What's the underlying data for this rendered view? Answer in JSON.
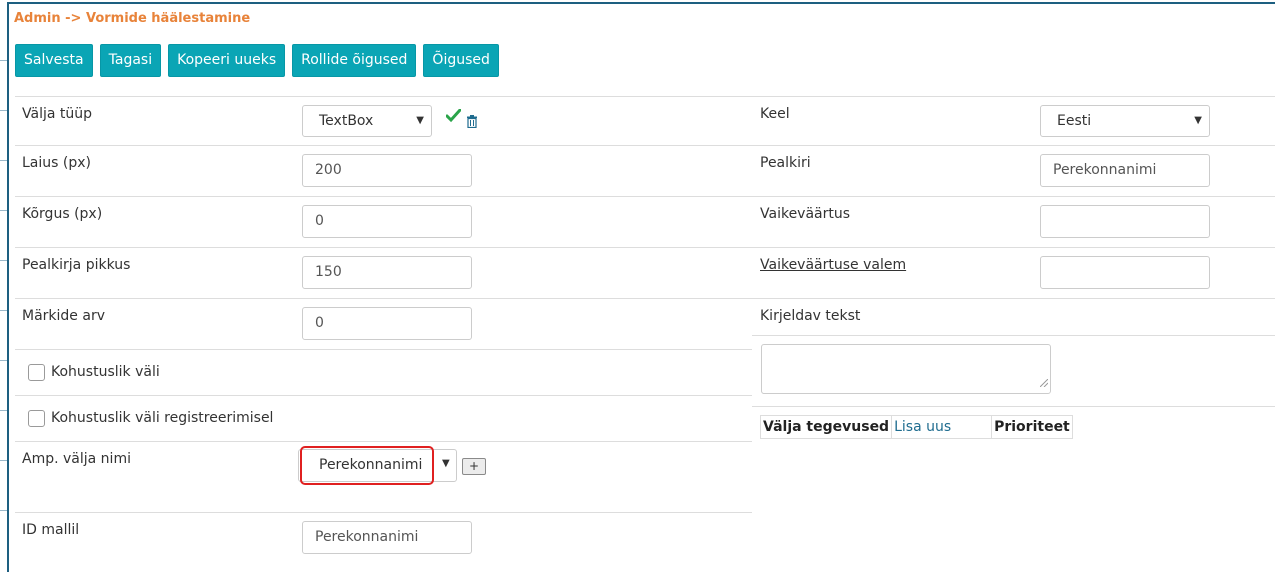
{
  "breadcrumb": "Admin -> Vormide häälestamine",
  "toolbar": {
    "save": "Salvesta",
    "back": "Tagasi",
    "copy_new": "Kopeeri uueks",
    "role_rights": "Rollide õigused",
    "rights": "Õigused"
  },
  "left": {
    "field_type": {
      "label": "Välja tüüp",
      "value": "TextBox"
    },
    "width": {
      "label": "Laius (px)",
      "value": "200"
    },
    "height": {
      "label": "Kõrgus (px)",
      "value": "0"
    },
    "title_length": {
      "label": "Pealkirja pikkus",
      "value": "150"
    },
    "char_count": {
      "label": "Märkide arv",
      "value": "0"
    },
    "required": {
      "label": "Kohustuslik väli",
      "checked": false
    },
    "required_reg": {
      "label": "Kohustuslik väli registreerimisel",
      "checked": false
    },
    "amp_field": {
      "label": "Amp. välja nimi",
      "value": "Perekonnanimi",
      "add": "+"
    },
    "template_id": {
      "label": "ID mallil",
      "value": "Perekonnanimi"
    }
  },
  "right": {
    "language": {
      "label": "Keel",
      "value": "Eesti"
    },
    "title": {
      "label": "Pealkiri",
      "value": "Perekonnanimi"
    },
    "default_value": {
      "label": "Vaikeväärtus",
      "value": ""
    },
    "default_formula": {
      "label": "Vaikeväärtuse valem",
      "value": ""
    },
    "description": {
      "label": "Kirjeldav tekst",
      "value": ""
    },
    "actions_table": {
      "col_actions": "Välja tegevused",
      "add_new": "Lisa uus",
      "col_priority": "Prioriteet"
    }
  },
  "colors": {
    "breadcrumb": "#e8833a",
    "button": "#0aa5b5",
    "highlight": "#e02020",
    "frame": "#1d5f80"
  },
  "icons": {
    "confirm": "check-icon",
    "delete": "trash-icon"
  }
}
